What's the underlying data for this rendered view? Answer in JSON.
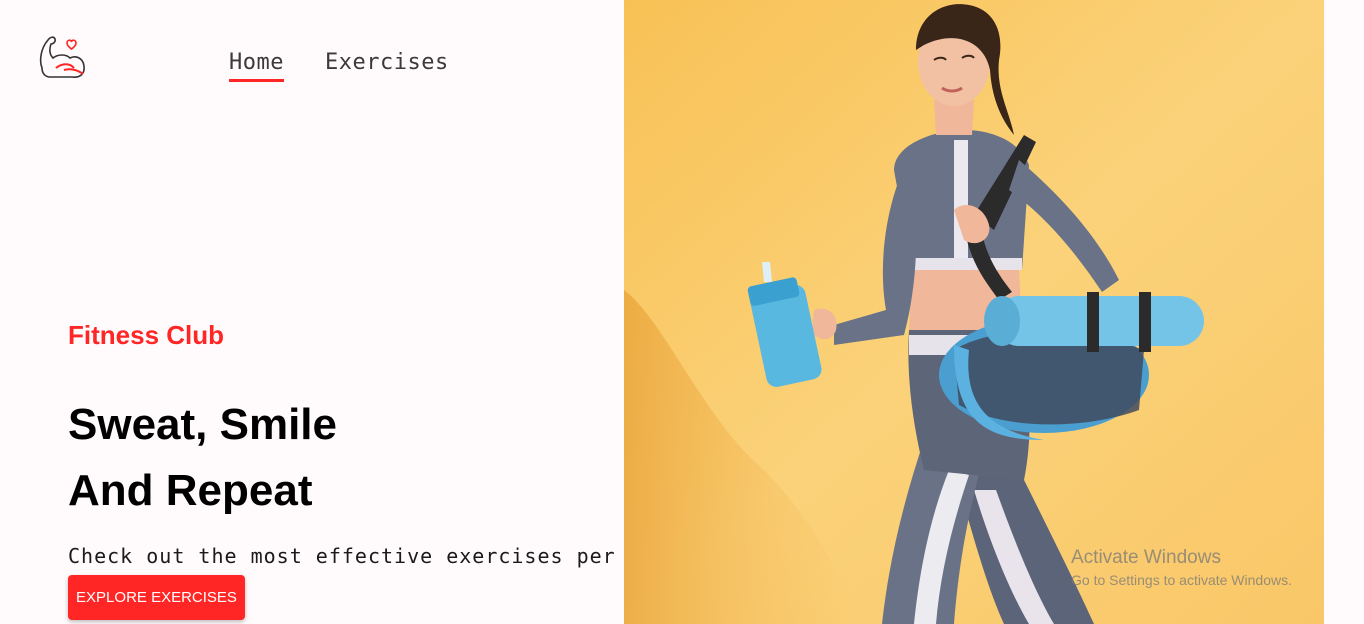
{
  "logo": {
    "icon": "flexed-arm-heart-icon"
  },
  "nav": {
    "items": [
      {
        "label": "Home",
        "active": true
      },
      {
        "label": "Exercises",
        "active": false
      }
    ]
  },
  "hero": {
    "kicker": "Fitness Club",
    "headline_line1": "Sweat, Smile",
    "headline_line2": "And Repeat",
    "subtext": "Check out the most effective exercises per",
    "cta_label": "Explore Exercises",
    "image": "woman-walking-with-gym-bag-and-shaker"
  },
  "watermark": {
    "title": "Activate Windows",
    "subtitle": "Go to Settings to activate Windows."
  },
  "colors": {
    "accent": "#ff2625",
    "page_bg": "#fffafb",
    "hero_bg": "#f9c95e"
  }
}
